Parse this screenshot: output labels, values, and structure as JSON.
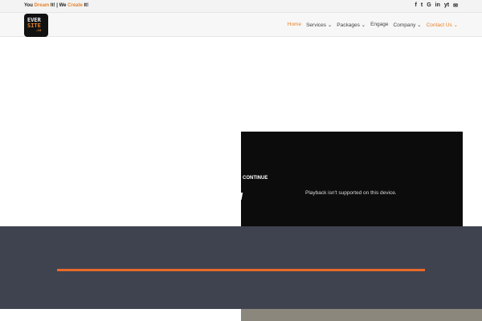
{
  "topbar": {
    "tagline": {
      "p1": "You ",
      "p2": "Dream",
      "p3": " It! | We ",
      "p4": "Create",
      "p5": " It!"
    },
    "social": [
      "f",
      "t",
      "G",
      "in",
      "yt",
      "✉"
    ]
  },
  "logo": {
    "line1": "EVER",
    "line2": "SITE",
    "line3": ".co"
  },
  "nav": [
    {
      "label": "Home"
    },
    {
      "label": "Services ⌄"
    },
    {
      "label": "Packages ⌄"
    },
    {
      "label": "Engage"
    },
    {
      "label": "Company ⌄"
    },
    {
      "label": "Contact Us ⌄"
    }
  ],
  "video": {
    "message": "Playback isn't supported on this device."
  },
  "continue_label": "CONTINUE",
  "colors": {
    "accent": "#e8832a",
    "band": "#3f4350"
  }
}
